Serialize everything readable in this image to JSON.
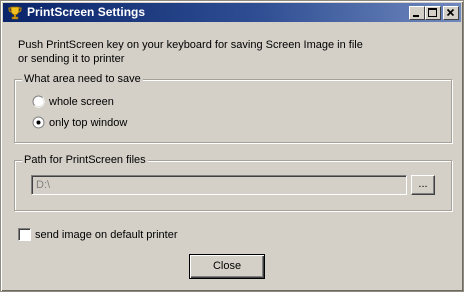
{
  "window": {
    "title": "PrintScreen Settings",
    "icon": "trophy-icon",
    "controls": [
      "minimize-icon",
      "maximize-icon",
      "close-icon"
    ]
  },
  "intro": {
    "line1": "Push PrintScreen key on your keyboard for saving Screen Image in file",
    "line2": "or sending it to printer"
  },
  "area_group": {
    "label": "What area need to save",
    "options": [
      {
        "label": "whole screen",
        "selected": false
      },
      {
        "label": "only top window",
        "selected": true
      }
    ]
  },
  "path_group": {
    "label": "Path for PrintScreen files",
    "value": "D:\\",
    "browse_label": "..."
  },
  "printer_option": {
    "label": "send image on default printer",
    "checked": false
  },
  "footer": {
    "close_label": "Close"
  }
}
